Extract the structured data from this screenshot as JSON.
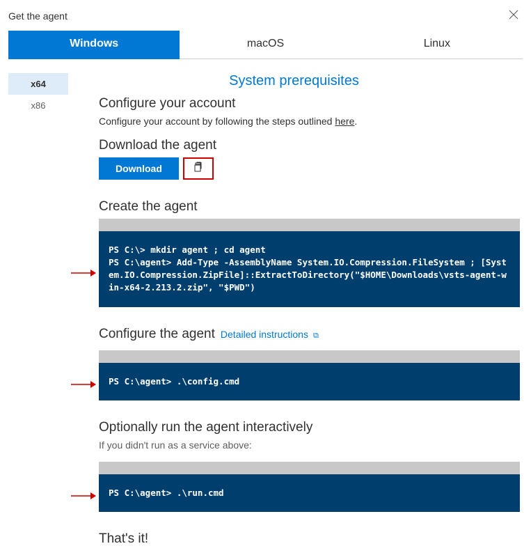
{
  "dialog": {
    "title": "Get the agent"
  },
  "tabs": {
    "windows": "Windows",
    "macos": "macOS",
    "linux": "Linux"
  },
  "arch": {
    "x64": "x64",
    "x86": "x86"
  },
  "prereq_link": "System prerequisites",
  "sections": {
    "configure_account": {
      "heading": "Configure your account",
      "text_before": "Configure your account by following the steps outlined ",
      "link": "here",
      "text_after": "."
    },
    "download": {
      "heading": "Download the agent",
      "button": "Download"
    },
    "create": {
      "heading": "Create the agent",
      "code": "PS C:\\> mkdir agent ; cd agent\nPS C:\\agent> Add-Type -AssemblyName System.IO.Compression.FileSystem ; [System.IO.Compression.ZipFile]::ExtractToDirectory(\"$HOME\\Downloads\\vsts-agent-win-x64-2.213.2.zip\", \"$PWD\")"
    },
    "configure_agent": {
      "heading": "Configure the agent",
      "link": "Detailed instructions",
      "code": "PS C:\\agent> .\\config.cmd"
    },
    "run": {
      "heading": "Optionally run the agent interactively",
      "sub": "If you didn't run as a service above:",
      "code": "PS C:\\agent> .\\run.cmd"
    },
    "done": {
      "heading": "That's it!"
    }
  }
}
